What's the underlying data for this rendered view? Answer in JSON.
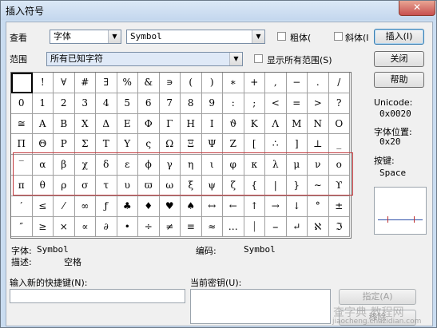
{
  "window": {
    "title": "插入符号",
    "close_glyph": "✕"
  },
  "toolbar": {
    "view_label": "查看",
    "view_value": "字体",
    "font_value": "Symbol",
    "bold_label": "粗体(",
    "italic_label": "斜体(I",
    "insert_label": "插入(I)"
  },
  "range": {
    "label": "范围",
    "value": "所有已知字符",
    "show_all_label": "显示所有范围(S)",
    "close_label": "关闭",
    "help_label": "帮助"
  },
  "grid": {
    "rows": [
      [
        " ",
        "!",
        "∀",
        "#",
        "∃",
        "%",
        "&",
        "∍",
        "(",
        ")",
        "∗",
        "+",
        ",",
        "−",
        ".",
        "/"
      ],
      [
        "0",
        "1",
        "2",
        "3",
        "4",
        "5",
        "6",
        "7",
        "8",
        "9",
        ":",
        ";",
        "<",
        "=",
        ">",
        "?"
      ],
      [
        "≅",
        "Α",
        "Β",
        "Χ",
        "Δ",
        "Ε",
        "Φ",
        "Γ",
        "Η",
        "Ι",
        "ϑ",
        "Κ",
        "Λ",
        "Μ",
        "Ν",
        "Ο"
      ],
      [
        "Π",
        "Θ",
        "Ρ",
        "Σ",
        "Τ",
        "Υ",
        "ς",
        "Ω",
        "Ξ",
        "Ψ",
        "Ζ",
        "[",
        "∴",
        "]",
        "⊥",
        "_"
      ],
      [
        "‾",
        "α",
        "β",
        "χ",
        "δ",
        "ε",
        "ϕ",
        "γ",
        "η",
        "ι",
        "φ",
        "κ",
        "λ",
        "μ",
        "ν",
        "ο"
      ],
      [
        "π",
        "θ",
        "ρ",
        "σ",
        "τ",
        "υ",
        "ϖ",
        "ω",
        "ξ",
        "ψ",
        "ζ",
        "{",
        "|",
        "}",
        "∼",
        "ϒ"
      ],
      [
        "′",
        "≤",
        "⁄",
        "∞",
        "ƒ",
        "♣",
        "♦",
        "♥",
        "♠",
        "↔",
        "←",
        "↑",
        "→",
        "↓",
        "°",
        "±"
      ],
      [
        "″",
        "≥",
        "×",
        "∝",
        "∂",
        "•",
        "÷",
        "≠",
        "≡",
        "≈",
        "…",
        "⏐",
        "⎯",
        "↵",
        "ℵ",
        "ℑ"
      ]
    ]
  },
  "info": {
    "unicode_label": "Unicode:",
    "unicode_value": "0x0020",
    "font_pos_label": "字体位置:",
    "font_pos_value": "0x20",
    "key_label": "按键:",
    "key_value": "Space"
  },
  "details": {
    "font_label": "字体:",
    "font_value": "Symbol",
    "code_label": "编码:",
    "code_value": "Symbol",
    "desc_label": "描述:",
    "desc_value": "空格"
  },
  "shortcut": {
    "new_label": "输入新的快捷键(N):",
    "current_label": "当前密钥(U):",
    "assign_label": "指定(A)",
    "remove_label": "移除"
  },
  "watermark": {
    "text": "查字典 教程网",
    "url": "jiaocheng.chazidian.com"
  }
}
